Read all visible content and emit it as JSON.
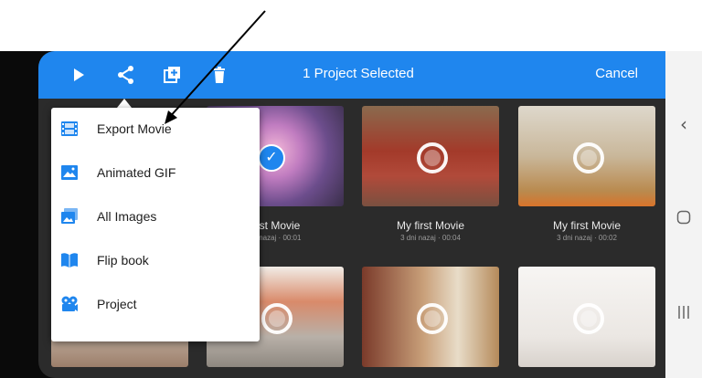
{
  "topbar": {
    "title": "1 Project Selected",
    "cancel": "Cancel",
    "icons": [
      "play-icon",
      "share-icon",
      "duplicate-icon",
      "trash-icon"
    ]
  },
  "menu": {
    "items": [
      {
        "label": "Export Movie",
        "icon": "film-icon"
      },
      {
        "label": "Animated GIF",
        "icon": "image-icon"
      },
      {
        "label": "All Images",
        "icon": "images-icon"
      },
      {
        "label": "Flip book",
        "icon": "book-icon"
      },
      {
        "label": "Project",
        "icon": "project-reel-icon"
      }
    ]
  },
  "projects": [
    {
      "title": "first Movie",
      "meta": "ov nazaj · 00:01",
      "selected": true
    },
    {
      "title": "My first Movie",
      "meta": "3 dni nazaj · 00:04",
      "selected": false
    },
    {
      "title": "My first Movie",
      "meta": "3 dni nazaj · 00:02",
      "selected": false
    }
  ],
  "colors": {
    "accent": "#1f86ee",
    "screen_bg": "#2b2b2b"
  }
}
